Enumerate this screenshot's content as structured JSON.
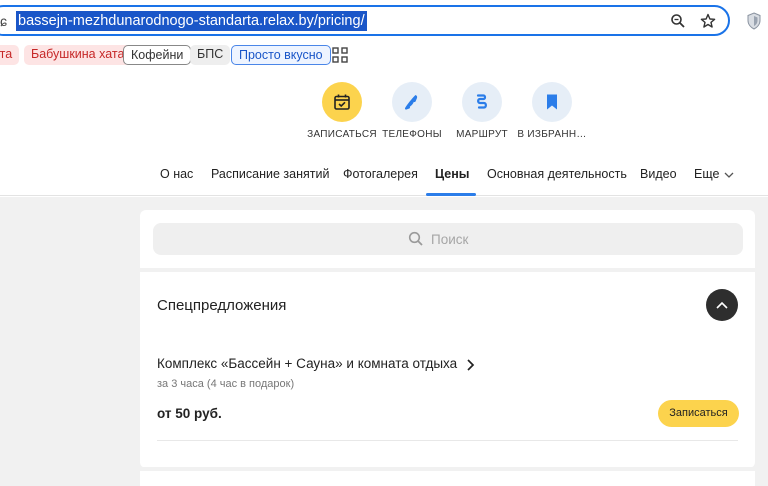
{
  "browser": {
    "url_lead": "ɕ",
    "url": "bassejn-mezhdunarodnogo-standarta.relax.by/pricing/",
    "icons": [
      "zoom-icon",
      "star-icon",
      "shield-extension-icon"
    ]
  },
  "bookmarks": {
    "items": [
      {
        "label": "ата",
        "style": "red"
      },
      {
        "label": "Бабушкина хата",
        "style": "red"
      },
      {
        "label": "Кофейни",
        "style": "outline"
      },
      {
        "label": "БПС",
        "style": "grey"
      },
      {
        "label": "Просто вкусно",
        "style": "blue"
      }
    ]
  },
  "actions": [
    {
      "label": "ЗАПИСАТЬСЯ",
      "icon": "calendar-check-icon",
      "color": "#fcd34d"
    },
    {
      "label": "ТЕЛЕФОНЫ",
      "icon": "phone-icon",
      "color": "#e6eef7"
    },
    {
      "label": "МАРШРУТ",
      "icon": "route-icon",
      "color": "#e6eef7"
    },
    {
      "label": "В ИЗБРАНН…",
      "icon": "bookmark-icon",
      "color": "#e6eef7"
    }
  ],
  "nav": {
    "tabs": [
      "О нас",
      "Расписание занятий",
      "Фотогалерея",
      "Цены",
      "Основная деятельность",
      "Видео",
      "Еще"
    ],
    "active": "Цены",
    "accent": "#2b7de9"
  },
  "search": {
    "placeholder": "Поиск"
  },
  "section": {
    "title": "Спецпредложения",
    "items": [
      {
        "title": "Комплекс «Бассейн + Сауна» и комната отдыха",
        "subtitle": "за 3 часа (4 час в подарок)",
        "price": "от 50 руб.",
        "button": "Записаться"
      }
    ]
  }
}
